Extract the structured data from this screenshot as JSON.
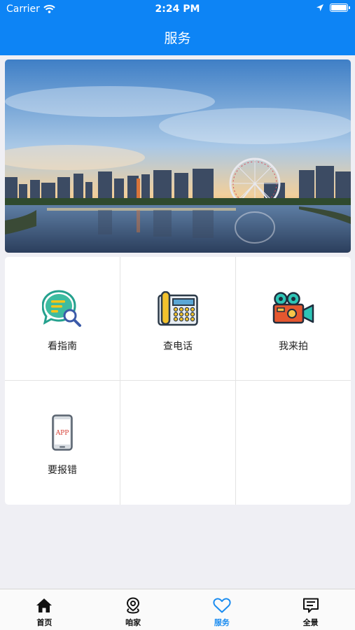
{
  "status_bar": {
    "carrier": "Carrier",
    "time": "2:24 PM"
  },
  "header": {
    "title": "服务"
  },
  "services": [
    {
      "label": "看指南",
      "icon": "guide-search-icon"
    },
    {
      "label": "查电话",
      "icon": "telephone-icon"
    },
    {
      "label": "我来拍",
      "icon": "video-camera-icon"
    },
    {
      "label": "要报错",
      "icon": "phone-app-icon",
      "icon_text": "APP"
    }
  ],
  "tabs": [
    {
      "label": "首页",
      "icon": "home-icon",
      "active": false
    },
    {
      "label": "咱家",
      "icon": "location-pin-icon",
      "active": false
    },
    {
      "label": "服务",
      "icon": "heart-icon",
      "active": true
    },
    {
      "label": "全景",
      "icon": "message-icon",
      "active": false
    }
  ],
  "colors": {
    "primary": "#0d84f5",
    "tab_active": "#1a8cf0"
  }
}
